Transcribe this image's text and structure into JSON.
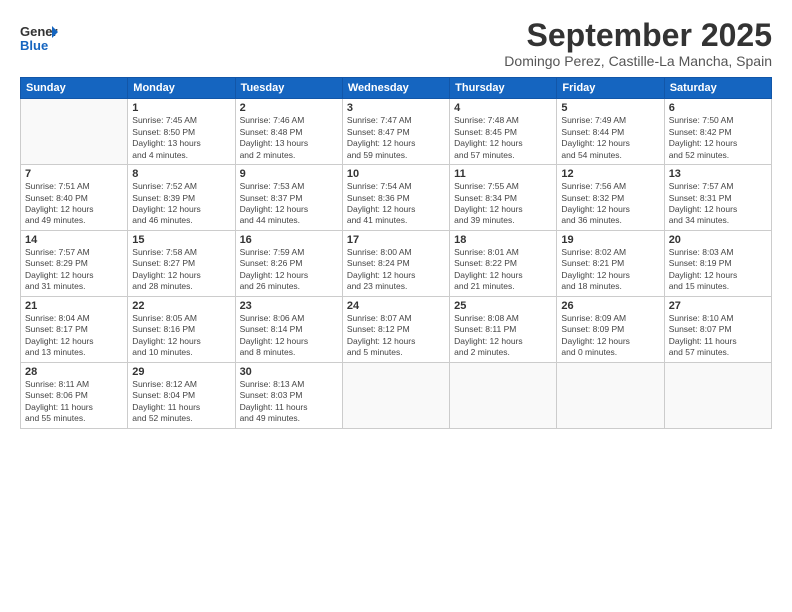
{
  "header": {
    "logo_general": "General",
    "logo_blue": "Blue",
    "title": "September 2025",
    "subtitle": "Domingo Perez, Castille-La Mancha, Spain"
  },
  "weekdays": [
    "Sunday",
    "Monday",
    "Tuesday",
    "Wednesday",
    "Thursday",
    "Friday",
    "Saturday"
  ],
  "weeks": [
    [
      {
        "day": "",
        "info": ""
      },
      {
        "day": "1",
        "info": "Sunrise: 7:45 AM\nSunset: 8:50 PM\nDaylight: 13 hours\nand 4 minutes."
      },
      {
        "day": "2",
        "info": "Sunrise: 7:46 AM\nSunset: 8:48 PM\nDaylight: 13 hours\nand 2 minutes."
      },
      {
        "day": "3",
        "info": "Sunrise: 7:47 AM\nSunset: 8:47 PM\nDaylight: 12 hours\nand 59 minutes."
      },
      {
        "day": "4",
        "info": "Sunrise: 7:48 AM\nSunset: 8:45 PM\nDaylight: 12 hours\nand 57 minutes."
      },
      {
        "day": "5",
        "info": "Sunrise: 7:49 AM\nSunset: 8:44 PM\nDaylight: 12 hours\nand 54 minutes."
      },
      {
        "day": "6",
        "info": "Sunrise: 7:50 AM\nSunset: 8:42 PM\nDaylight: 12 hours\nand 52 minutes."
      }
    ],
    [
      {
        "day": "7",
        "info": "Sunrise: 7:51 AM\nSunset: 8:40 PM\nDaylight: 12 hours\nand 49 minutes."
      },
      {
        "day": "8",
        "info": "Sunrise: 7:52 AM\nSunset: 8:39 PM\nDaylight: 12 hours\nand 46 minutes."
      },
      {
        "day": "9",
        "info": "Sunrise: 7:53 AM\nSunset: 8:37 PM\nDaylight: 12 hours\nand 44 minutes."
      },
      {
        "day": "10",
        "info": "Sunrise: 7:54 AM\nSunset: 8:36 PM\nDaylight: 12 hours\nand 41 minutes."
      },
      {
        "day": "11",
        "info": "Sunrise: 7:55 AM\nSunset: 8:34 PM\nDaylight: 12 hours\nand 39 minutes."
      },
      {
        "day": "12",
        "info": "Sunrise: 7:56 AM\nSunset: 8:32 PM\nDaylight: 12 hours\nand 36 minutes."
      },
      {
        "day": "13",
        "info": "Sunrise: 7:57 AM\nSunset: 8:31 PM\nDaylight: 12 hours\nand 34 minutes."
      }
    ],
    [
      {
        "day": "14",
        "info": "Sunrise: 7:57 AM\nSunset: 8:29 PM\nDaylight: 12 hours\nand 31 minutes."
      },
      {
        "day": "15",
        "info": "Sunrise: 7:58 AM\nSunset: 8:27 PM\nDaylight: 12 hours\nand 28 minutes."
      },
      {
        "day": "16",
        "info": "Sunrise: 7:59 AM\nSunset: 8:26 PM\nDaylight: 12 hours\nand 26 minutes."
      },
      {
        "day": "17",
        "info": "Sunrise: 8:00 AM\nSunset: 8:24 PM\nDaylight: 12 hours\nand 23 minutes."
      },
      {
        "day": "18",
        "info": "Sunrise: 8:01 AM\nSunset: 8:22 PM\nDaylight: 12 hours\nand 21 minutes."
      },
      {
        "day": "19",
        "info": "Sunrise: 8:02 AM\nSunset: 8:21 PM\nDaylight: 12 hours\nand 18 minutes."
      },
      {
        "day": "20",
        "info": "Sunrise: 8:03 AM\nSunset: 8:19 PM\nDaylight: 12 hours\nand 15 minutes."
      }
    ],
    [
      {
        "day": "21",
        "info": "Sunrise: 8:04 AM\nSunset: 8:17 PM\nDaylight: 12 hours\nand 13 minutes."
      },
      {
        "day": "22",
        "info": "Sunrise: 8:05 AM\nSunset: 8:16 PM\nDaylight: 12 hours\nand 10 minutes."
      },
      {
        "day": "23",
        "info": "Sunrise: 8:06 AM\nSunset: 8:14 PM\nDaylight: 12 hours\nand 8 minutes."
      },
      {
        "day": "24",
        "info": "Sunrise: 8:07 AM\nSunset: 8:12 PM\nDaylight: 12 hours\nand 5 minutes."
      },
      {
        "day": "25",
        "info": "Sunrise: 8:08 AM\nSunset: 8:11 PM\nDaylight: 12 hours\nand 2 minutes."
      },
      {
        "day": "26",
        "info": "Sunrise: 8:09 AM\nSunset: 8:09 PM\nDaylight: 12 hours\nand 0 minutes."
      },
      {
        "day": "27",
        "info": "Sunrise: 8:10 AM\nSunset: 8:07 PM\nDaylight: 11 hours\nand 57 minutes."
      }
    ],
    [
      {
        "day": "28",
        "info": "Sunrise: 8:11 AM\nSunset: 8:06 PM\nDaylight: 11 hours\nand 55 minutes."
      },
      {
        "day": "29",
        "info": "Sunrise: 8:12 AM\nSunset: 8:04 PM\nDaylight: 11 hours\nand 52 minutes."
      },
      {
        "day": "30",
        "info": "Sunrise: 8:13 AM\nSunset: 8:03 PM\nDaylight: 11 hours\nand 49 minutes."
      },
      {
        "day": "",
        "info": ""
      },
      {
        "day": "",
        "info": ""
      },
      {
        "day": "",
        "info": ""
      },
      {
        "day": "",
        "info": ""
      }
    ]
  ]
}
